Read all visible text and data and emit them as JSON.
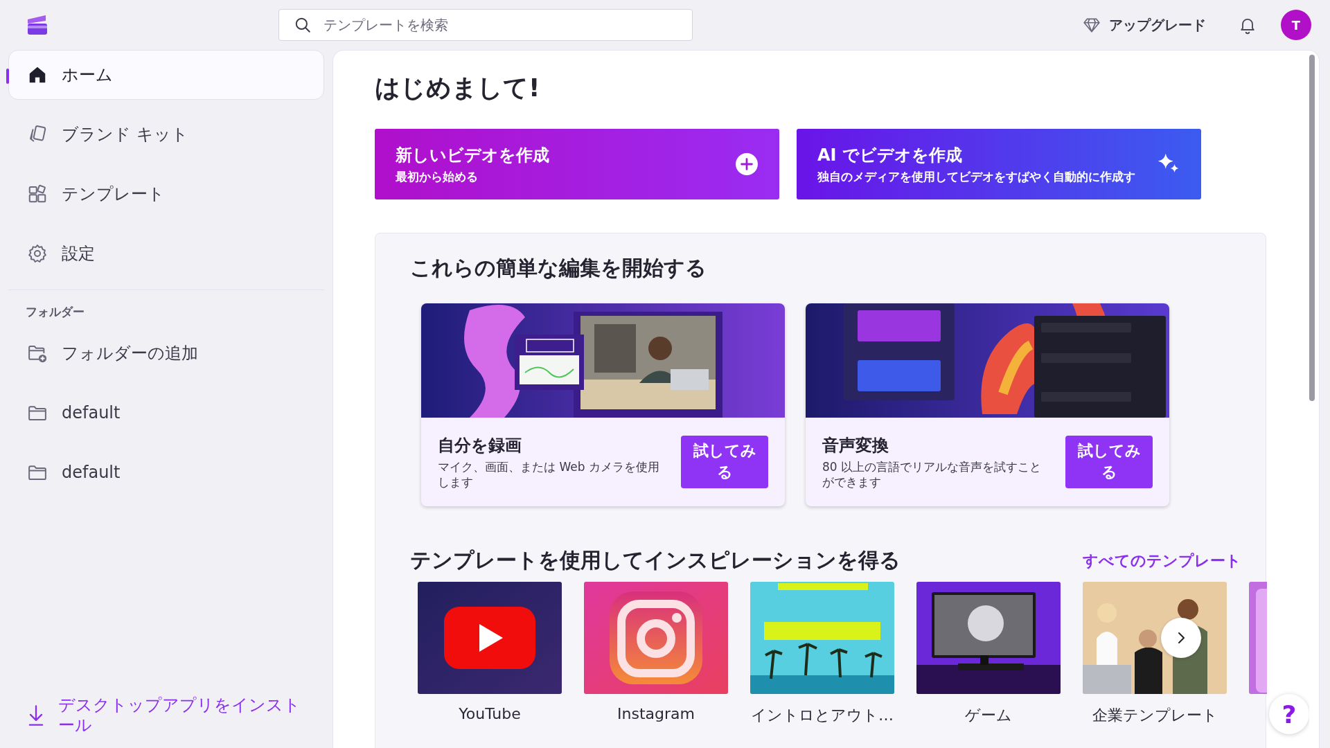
{
  "search": {
    "placeholder": "テンプレートを検索"
  },
  "header": {
    "upgrade": "アップグレード",
    "avatar": "T"
  },
  "sidebar": {
    "items": [
      {
        "label": "ホーム",
        "kind": "home",
        "selected": true
      },
      {
        "label": "ブランド キット",
        "kind": "brand",
        "selected": false
      },
      {
        "label": "テンプレート",
        "kind": "template",
        "selected": false
      },
      {
        "label": "設定",
        "kind": "settings",
        "selected": false
      }
    ],
    "folders_heading": "フォルダー",
    "folders": [
      {
        "label": "フォルダーの追加",
        "kind": "add"
      },
      {
        "label": "default",
        "kind": "folder"
      },
      {
        "label": "default",
        "kind": "folder"
      }
    ],
    "install": "デスクトップアプリをインストール"
  },
  "main": {
    "greeting": "はじめまして!",
    "create_buttons": [
      {
        "kind": "new",
        "title": "新しいビデオを作成",
        "subtitle": "最初から始める"
      },
      {
        "kind": "ai",
        "title": "AI でビデオを作成",
        "subtitle": "独自のメディアを使用してビデオをすばやく自動的に作成す"
      }
    ],
    "quick_edits": {
      "title": "これらの簡単な編集を開始する",
      "cards": [
        {
          "kind": "record",
          "title": "自分を録画",
          "description": "マイク、画面、または Web カメラを使用します",
          "button": "試してみる"
        },
        {
          "kind": "voice",
          "title": "音声変換",
          "description": "80 以上の言語でリアルな音声を試すことができます",
          "button": "試してみる"
        }
      ]
    },
    "templates": {
      "title": "テンプレートを使用してインスピレーションを得る",
      "see_all": "すべてのテンプレート",
      "items": [
        {
          "kind": "youtube",
          "label": "YouTube"
        },
        {
          "kind": "instagram",
          "label": "Instagram"
        },
        {
          "kind": "beach",
          "label": "イントロとアウト…"
        },
        {
          "kind": "gaming",
          "label": "ゲーム"
        },
        {
          "kind": "office",
          "label": "企業テンプレート"
        },
        {
          "kind": "partial"
        }
      ]
    },
    "help": "?"
  }
}
